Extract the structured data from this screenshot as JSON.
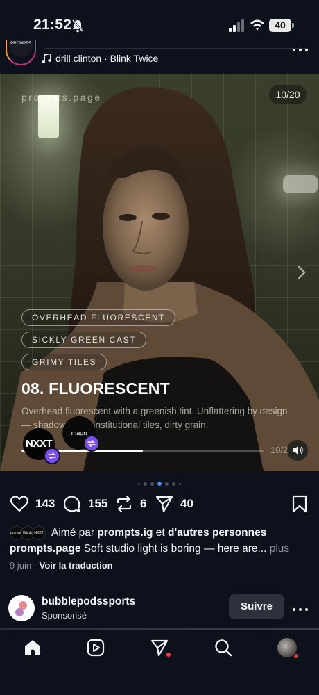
{
  "status_bar": {
    "time": "21:52",
    "battery": "40"
  },
  "post": {
    "account_avatar_text": "PROMPTS",
    "audio": "drill clinton · Blink Twice"
  },
  "media": {
    "watermark": "prompts.page",
    "counter": "10/20",
    "tags": [
      "OVERHEAD FLUORESCENT",
      "SICKLY GREEN CAST",
      "GRIMY TILES"
    ],
    "title": "08. FLUORESCENT",
    "description": "Overhead fluorescent with a greenish tint. Unflattering by design — shadow          eyes, institutional tiles, dirty grain.",
    "progress_label": "10/2",
    "progress": 0.5,
    "collab_1": "NXXT",
    "collab_2": "magn"
  },
  "carousel_dots": {
    "count": 7,
    "active_index": 3
  },
  "actions": {
    "likes": "143",
    "comments": "155",
    "reposts": "6",
    "shares": "40"
  },
  "liked_by": {
    "avatars": [
      "prompts",
      "Wb.da",
      "NXXT"
    ],
    "prefix": "Aimé par ",
    "user": "prompts.ig",
    "connector": " et ",
    "others": "d'autres personnes"
  },
  "caption": {
    "username": "prompts.page",
    "text": " Soft studio light is boring — here are...",
    "more": " plus"
  },
  "meta": {
    "date": "9 juin",
    "separator": " · ",
    "translate": "Voir la traduction"
  },
  "sponsored": {
    "name": "bubblepodssports",
    "label": "Sponsorisé",
    "follow": "Suivre"
  },
  "colors": {
    "background": "#0c111b",
    "accent_dot": "#4a90f2",
    "notification": "#ff3040",
    "remix": "#7b4cf2"
  }
}
